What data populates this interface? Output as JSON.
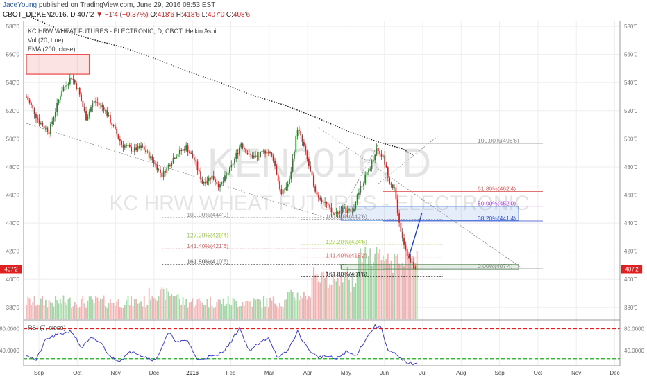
{
  "header": {
    "author": "JaceYoung",
    "published": "published on TradingView.com, June 29, 2016 08:53 EST"
  },
  "symbol_bar": {
    "symbol": "CBOT_DL:KEN2016, D",
    "last": "407'2",
    "change": "−1'4 (−0.37%)",
    "open_label": "O:",
    "open": "418'6",
    "high_label": "H:",
    "high": "418'6",
    "low_label": "L:",
    "low": "407'0",
    "close_label": "C:",
    "close": "408'6"
  },
  "legend": {
    "line1": "KC HRW WHEAT FUTURES - ELECTRONIC, D, CBOT, Heikin Ashi",
    "line2": "Vol (20, true)",
    "line3": "EMA (200, close)"
  },
  "watermark": {
    "symbol": "KEN2016, D",
    "name": "KC HRW WHEAT FUTURES - ELECTRONIC"
  },
  "colors": {
    "up": "#2e7d32",
    "down": "#c62828",
    "vol_up": "#a5d6a7",
    "vol_down": "#f0b2b2",
    "ema": "#111111",
    "rsi": "#3a3ad0",
    "rsi_upper": "#e02020",
    "rsi_lower": "#22aa22",
    "price_tag": "#e02020"
  },
  "chart_data": [
    {
      "type": "candlestick",
      "title": "KC HRW WHEAT FUTURES - ELECTRONIC, D, CBOT, Heikin Ashi",
      "x_ticks": [
        "Sep",
        "Oct",
        "Nov",
        "Dec",
        "2016",
        "Feb",
        "Mar",
        "Apr",
        "May",
        "Jun",
        "Jul",
        "Aug",
        "Sep",
        "Oct",
        "Nov",
        "Dec"
      ],
      "y_ticks": [
        "580'0",
        "560'0",
        "540'0",
        "520'0",
        "500'0",
        "480'0",
        "460'0",
        "440'0",
        "420'0",
        "400'0",
        "380'0"
      ],
      "ylim": [
        372,
        584
      ],
      "current_price_label": "407'2",
      "price_anchors": [
        [
          0,
          530
        ],
        [
          8,
          512
        ],
        [
          14,
          505
        ],
        [
          22,
          535
        ],
        [
          28,
          544
        ],
        [
          32,
          535
        ],
        [
          37,
          515
        ],
        [
          42,
          527
        ],
        [
          48,
          522
        ],
        [
          54,
          508
        ],
        [
          59,
          496
        ],
        [
          66,
          492
        ],
        [
          72,
          494
        ],
        [
          78,
          485
        ],
        [
          84,
          474
        ],
        [
          92,
          488
        ],
        [
          99,
          494
        ],
        [
          104,
          485
        ],
        [
          109,
          469
        ],
        [
          115,
          473
        ],
        [
          120,
          466
        ],
        [
          127,
          480
        ],
        [
          133,
          497
        ],
        [
          138,
          488
        ],
        [
          143,
          487
        ],
        [
          149,
          492
        ],
        [
          153,
          486
        ],
        [
          158,
          460
        ],
        [
          163,
          470
        ],
        [
          168,
          508
        ],
        [
          172,
          494
        ],
        [
          176,
          476
        ],
        [
          180,
          460
        ],
        [
          185,
          455
        ],
        [
          190,
          446
        ],
        [
          196,
          450
        ],
        [
          202,
          448
        ],
        [
          207,
          466
        ],
        [
          212,
          477
        ],
        [
          217,
          493
        ],
        [
          221,
          487
        ],
        [
          225,
          470
        ],
        [
          228,
          464
        ],
        [
          231,
          440
        ],
        [
          234,
          426
        ],
        [
          237,
          414
        ],
        [
          240,
          409
        ],
        [
          242,
          408
        ]
      ],
      "ema_200": [
        [
          0,
          588
        ],
        [
          20,
          578
        ],
        [
          40,
          571
        ],
        [
          60,
          565
        ],
        [
          80,
          557
        ],
        [
          100,
          548
        ],
        [
          120,
          540
        ],
        [
          140,
          531
        ],
        [
          160,
          524
        ],
        [
          180,
          515
        ],
        [
          200,
          505
        ],
        [
          220,
          497
        ],
        [
          233,
          493
        ],
        [
          240,
          488
        ]
      ],
      "volume_range": [
        0,
        60
      ],
      "rectangles": [
        {
          "x0": 0,
          "x1": 39,
          "y0": 546,
          "y1": 560,
          "color": "#ee4444"
        },
        {
          "x0": 195,
          "x1": 305,
          "y0": 442,
          "y1": 452,
          "color": "#4a86d8"
        },
        {
          "x0": 195,
          "x1": 305,
          "y0": 407,
          "y1": 410.5,
          "color": "#558855"
        }
      ],
      "trend_lines": [
        {
          "x0": 0,
          "y0": 511,
          "x1": 185,
          "y1": 444,
          "color": "#888888",
          "dash": true
        },
        {
          "x0": 181,
          "y0": 508,
          "x1": 307,
          "y1": 408,
          "color": "#888888",
          "dash": true
        },
        {
          "x0": 194,
          "y0": 446,
          "x1": 218,
          "y1": 496,
          "color": "#888888",
          "dash": true
        },
        {
          "x0": 218,
          "y0": 468,
          "x1": 255,
          "y1": 502,
          "color": "#888888",
          "dash": true
        },
        {
          "x0": 237,
          "y0": 416,
          "x1": 245,
          "y1": 447,
          "color": "#2040d0",
          "dash": false
        }
      ],
      "fib_levels": [
        {
          "label": "100.00%(444'0)",
          "value": 444,
          "x0": 84,
          "x1": 199,
          "color": "#888888",
          "dash": true
        },
        {
          "label": "127.20%(429'4)",
          "value": 429.5,
          "x0": 84,
          "x1": 199,
          "color": "#9acd32",
          "dash": true
        },
        {
          "label": "141.40%(421'6)",
          "value": 421.75,
          "x0": 84,
          "x1": 199,
          "color": "#e06060",
          "dash": true
        },
        {
          "label": "161.80%(410'6)",
          "value": 410.75,
          "x0": 84,
          "x1": 199,
          "color": "#555555",
          "dash": true
        },
        {
          "label": "100.00%(442'6)",
          "value": 442.75,
          "x0": 170,
          "x1": 258,
          "color": "#888888",
          "dash": true
        },
        {
          "label": "127.20%(424'6)",
          "value": 424.75,
          "x0": 170,
          "x1": 258,
          "color": "#9acd32",
          "dash": true
        },
        {
          "label": "141.40%(415'2)",
          "value": 415.25,
          "x0": 170,
          "x1": 258,
          "color": "#e06060",
          "dash": true
        },
        {
          "label": "161.80%(401'6)",
          "value": 401.75,
          "x0": 170,
          "x1": 258,
          "color": "#222222",
          "dash": true
        },
        {
          "label": "100.00%(496'6)",
          "value": 496.75,
          "x0": 221,
          "x1": 320,
          "color": "#888888",
          "dash": false
        },
        {
          "label": "61.80%(462'4)",
          "value": 462.5,
          "x0": 221,
          "x1": 320,
          "color": "#e06060",
          "dash": false
        },
        {
          "label": "50.00%(452'0)",
          "value": 452,
          "x0": 221,
          "x1": 320,
          "color": "#aa44dd",
          "dash": false
        },
        {
          "label": "38.20%(441'4)",
          "value": 441.5,
          "x0": 221,
          "x1": 320,
          "color": "#3344cc",
          "dash": false
        },
        {
          "label": "0.00%(407'4)",
          "value": 407.5,
          "x0": 221,
          "x1": 320,
          "color": "#888888",
          "dash": false
        }
      ]
    },
    {
      "type": "line",
      "title": "RSI (7, close)",
      "y_ticks": [
        "80.0000",
        "40.0000"
      ],
      "ylim": [
        12,
        96
      ],
      "upper_level": 80,
      "lower_level": 25,
      "rsi_anchors": [
        [
          0,
          33
        ],
        [
          6,
          22
        ],
        [
          12,
          60
        ],
        [
          20,
          70
        ],
        [
          28,
          76
        ],
        [
          34,
          45
        ],
        [
          40,
          62
        ],
        [
          46,
          55
        ],
        [
          52,
          28
        ],
        [
          58,
          22
        ],
        [
          66,
          40
        ],
        [
          72,
          30
        ],
        [
          80,
          22
        ],
        [
          88,
          72
        ],
        [
          94,
          55
        ],
        [
          100,
          58
        ],
        [
          106,
          22
        ],
        [
          112,
          28
        ],
        [
          118,
          30
        ],
        [
          125,
          48
        ],
        [
          132,
          82
        ],
        [
          138,
          40
        ],
        [
          144,
          52
        ],
        [
          150,
          65
        ],
        [
          156,
          25
        ],
        [
          162,
          40
        ],
        [
          168,
          75
        ],
        [
          174,
          45
        ],
        [
          180,
          28
        ],
        [
          186,
          30
        ],
        [
          192,
          24
        ],
        [
          198,
          38
        ],
        [
          204,
          30
        ],
        [
          210,
          60
        ],
        [
          216,
          85
        ],
        [
          220,
          82
        ],
        [
          224,
          40
        ],
        [
          228,
          34
        ],
        [
          232,
          24
        ],
        [
          236,
          18
        ],
        [
          242,
          14
        ]
      ]
    }
  ]
}
